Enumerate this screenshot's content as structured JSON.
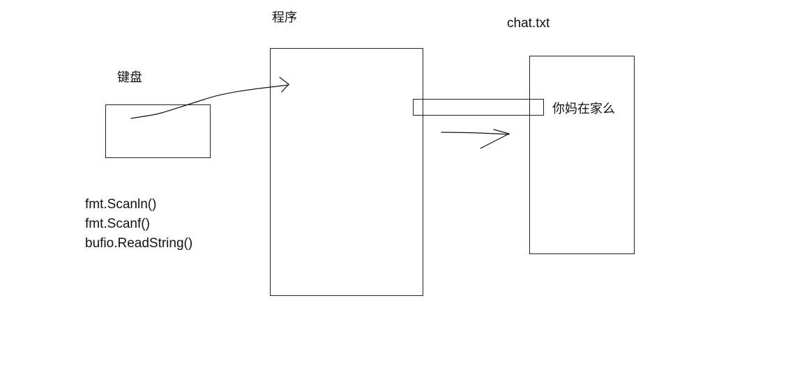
{
  "labels": {
    "keyboard": "键盘",
    "program": "程序",
    "file": "chat.txt",
    "buffer_text": "你妈在家么"
  },
  "read_methods": [
    "fmt.Scanln()",
    "fmt.Scanf()",
    "bufio.ReadString()"
  ],
  "colors": {
    "stroke": "#222222",
    "text": "#111111",
    "background": "#ffffff"
  }
}
